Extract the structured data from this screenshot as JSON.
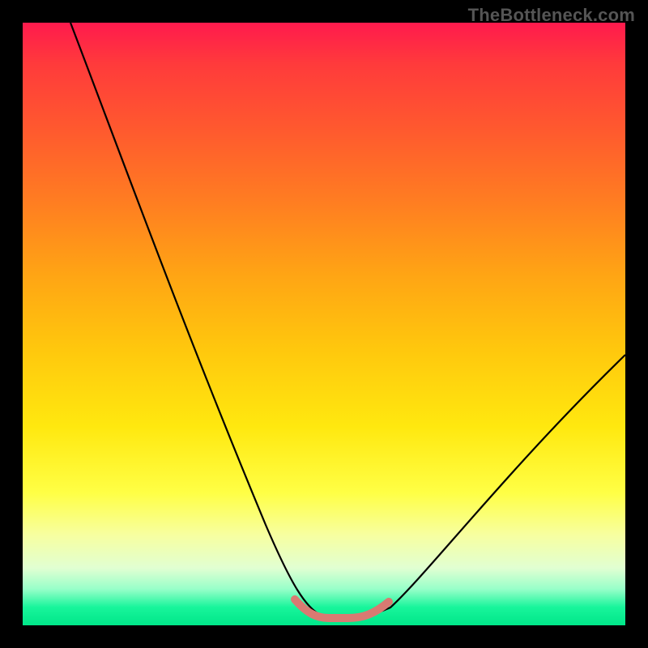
{
  "watermark": "TheBottleneck.com",
  "chart_data": {
    "type": "line",
    "title": "",
    "xlabel": "",
    "ylabel": "",
    "xlim": [
      0,
      100
    ],
    "ylim": [
      0,
      100
    ],
    "background_gradient": {
      "top": "#ff1a4d",
      "mid": "#ffe80f",
      "bottom": "#00e689"
    },
    "series": [
      {
        "name": "main-curve",
        "color": "#000000",
        "x": [
          8,
          12,
          16,
          20,
          24,
          28,
          32,
          36,
          40,
          44,
          47,
          49,
          51,
          54,
          57,
          60,
          64,
          70,
          76,
          82,
          88,
          94,
          100
        ],
        "y": [
          100,
          89,
          79,
          69,
          60,
          51,
          42,
          33,
          24,
          15,
          8,
          4,
          2,
          2,
          2,
          4,
          8,
          15,
          24,
          32,
          40,
          48,
          56
        ]
      },
      {
        "name": "highlight-band",
        "color": "#d87a72",
        "x": [
          47,
          49,
          51,
          54,
          57,
          60
        ],
        "y": [
          6,
          3,
          2,
          2,
          3,
          6
        ]
      }
    ]
  }
}
